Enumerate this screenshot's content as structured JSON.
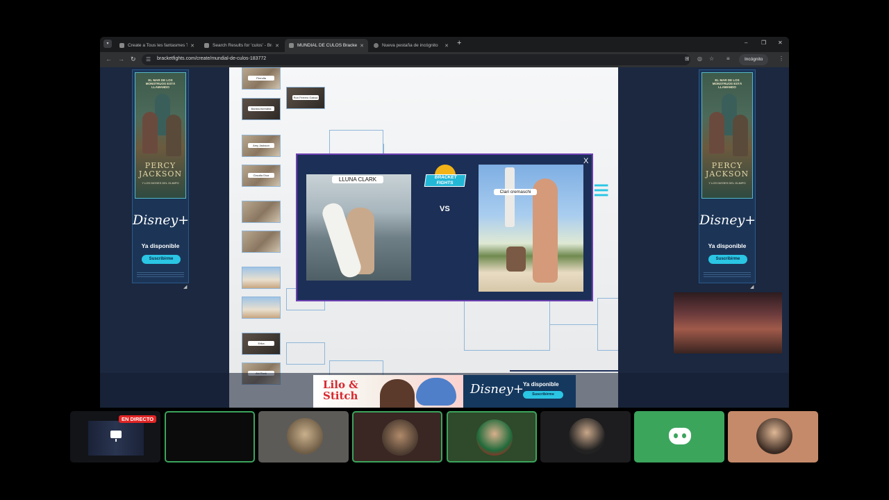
{
  "browser": {
    "tabs": [
      {
        "label": "Create a Tous les fantasmes Tie..."
      },
      {
        "label": "Search Results for 'culos' - Bra..."
      },
      {
        "label": "MUNDIAL DE CULOS Bracket -..."
      },
      {
        "label": "Nueva pestaña de incógnito"
      }
    ],
    "url": "bracketfights.com/create/mundial-de-culos-183772",
    "incognito_label": "Incógnito"
  },
  "ads": {
    "left": {
      "headline": "EL MAR DE LOS MONSTRUOS ESTÁ LLAMANDO",
      "title_line1": "PERCY",
      "title_line2": "JACKSON",
      "subtitle": "Y LOS DIOSES DEL OLIMPO",
      "brand": "Disney+",
      "available": "Ya disponible",
      "cta": "Suscribirme"
    },
    "right": {
      "headline": "EL MAR DE LOS MONSTRUOS ESTÁ LLAMANDO",
      "title_line1": "PERCY",
      "title_line2": "JACKSON",
      "subtitle": "Y LOS DIOSES DEL OLIMPO",
      "brand": "Disney+",
      "available": "Ya disponible",
      "cta": "Suscribirme"
    },
    "bottom": {
      "movie_line1": "Lilo &",
      "movie_line2": "Stitch",
      "brand": "Disney+",
      "available": "Ya disponible",
      "cta": "Suscribirme"
    }
  },
  "bracket": {
    "seeds": [
      "Perrolla",
      "Bardouniveralita",
      "Amy Jackson",
      "Claudia Díaz",
      "",
      "",
      "",
      "",
      "Erika",
      "Abi Rock"
    ],
    "round2": [
      "Ron Ferrero Gaboa"
    ]
  },
  "matchup": {
    "close_label": "X",
    "logo_line1": "BRACKET",
    "logo_line2": "FIGHTS",
    "vs_label": "VS",
    "left_name": "LLUNA CLARK",
    "right_name": "Clari cremaschi"
  },
  "stream": {
    "live_badge": "EN DIRECTO",
    "tiles": 8
  }
}
